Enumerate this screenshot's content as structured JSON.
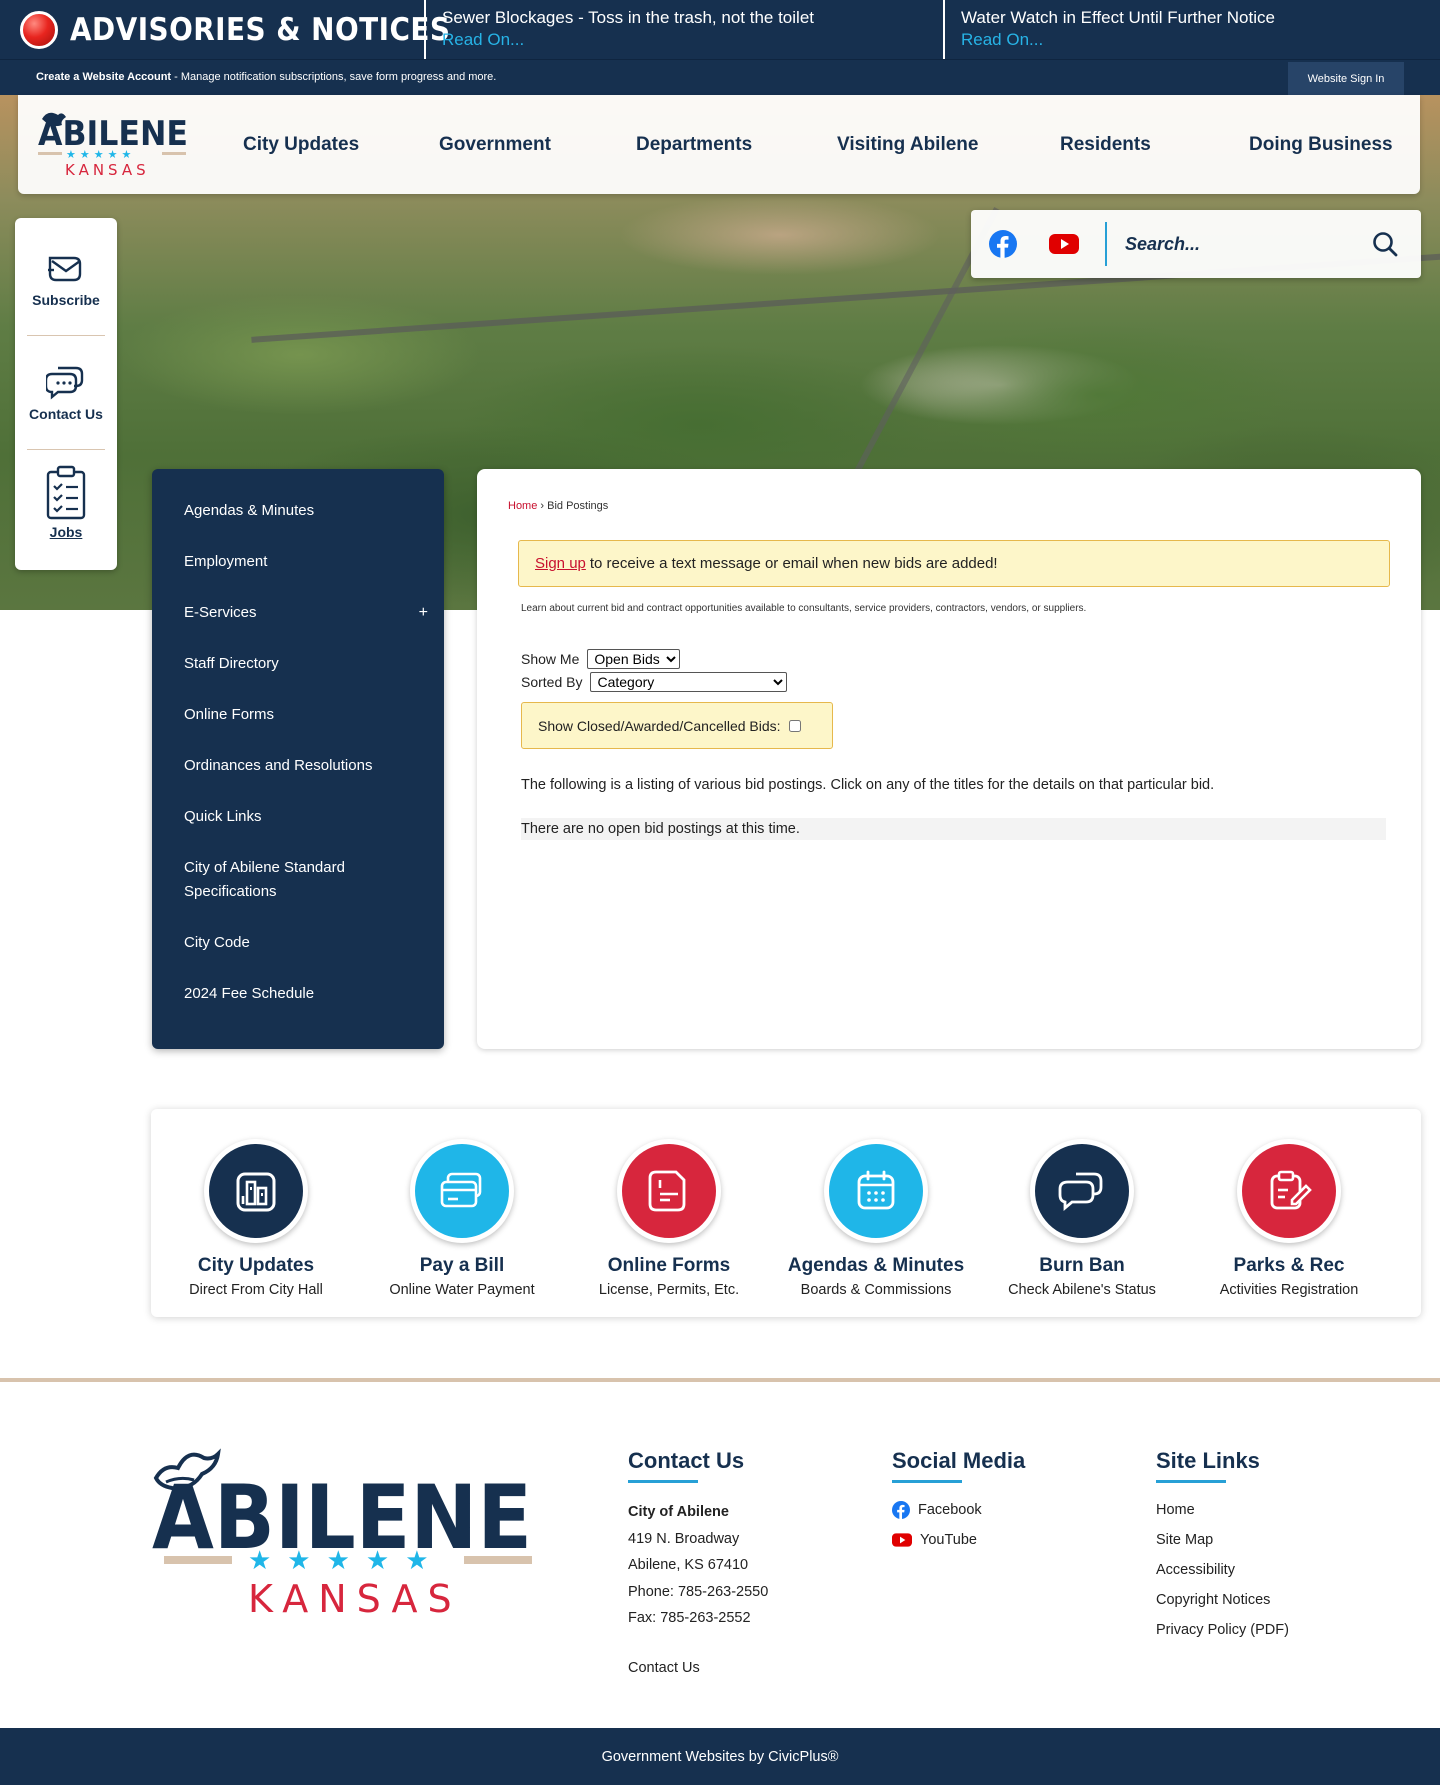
{
  "advisories": {
    "title": "ADVISORIES & NOTICES",
    "items": [
      {
        "title": "Sewer Blockages - Toss in the trash, not the toilet",
        "link": "Read On..."
      },
      {
        "title": "Water Watch in Effect Until Further Notice",
        "link": "Read On..."
      }
    ]
  },
  "account_bar": {
    "create_label": "Create a Website Account",
    "create_desc": " - Manage notification subscriptions, save form progress and more.",
    "signin_label": "Website Sign In"
  },
  "header": {
    "logo_text": "ABILENE",
    "logo_sub": "KANSAS",
    "nav": [
      "City Updates",
      "Government",
      "Departments",
      "Visiting Abilene",
      "Residents",
      "Doing Business"
    ]
  },
  "search": {
    "placeholder": "Search..."
  },
  "quick_actions": [
    {
      "label": "Subscribe"
    },
    {
      "label": "Contact Us"
    },
    {
      "label": "Jobs"
    }
  ],
  "sidenav": {
    "items": [
      "Agendas & Minutes",
      "Employment",
      "E-Services",
      "Staff Directory",
      "Online Forms",
      "Ordinances and Resolutions",
      "Quick Links",
      "City of Abilene Standard Specifications",
      "City Code",
      "2024 Fee Schedule"
    ],
    "expand_symbol": "+"
  },
  "main": {
    "breadcrumb": {
      "home": "Home",
      "separator": " › ",
      "current": "Bid Postings"
    },
    "alert": {
      "link": "Sign up",
      "text": "to receive a text message or email when new bids are added!"
    },
    "intro_small": "Learn about current bid and contract opportunities available to consultants, service providers, contractors, vendors, or suppliers.",
    "show_me_label": "Show Me",
    "show_me_value": "Open Bids",
    "sorted_by_label": "Sorted By",
    "sorted_by_value": "Category",
    "closed_label": "Show Closed/Awarded/Cancelled Bids:",
    "listing_intro": "The following is a listing of various bid postings. Click on any of the titles for the details on that particular bid.",
    "no_bids": "There are no open bid postings at this time."
  },
  "quick_links": [
    {
      "title": "City Updates",
      "sub": "Direct From City Hall",
      "color": "#16304f",
      "icon": "building-icon"
    },
    {
      "title": "Pay a Bill",
      "sub": "Online Water Payment",
      "color": "#1fb6e8",
      "icon": "credit-card-icon"
    },
    {
      "title": "Online Forms",
      "sub": "License, Permits, Etc.",
      "color": "#d7263d",
      "icon": "form-icon"
    },
    {
      "title": "Agendas & Minutes",
      "sub": "Boards & Commissions",
      "color": "#1fb6e8",
      "icon": "calendar-icon"
    },
    {
      "title": "Burn Ban",
      "sub": "Check Abilene's Status",
      "color": "#16304f",
      "icon": "chat-icon"
    },
    {
      "title": "Parks & Rec",
      "sub": "Activities Registration",
      "color": "#d7263d",
      "icon": "clipboard-edit-icon"
    }
  ],
  "footer": {
    "logo_text": "ABILENE",
    "logo_sub": "KANSAS",
    "contact": {
      "title": "Contact Us",
      "org": "City of Abilene",
      "lines": [
        "419 N. Broadway",
        "Abilene, KS 67410",
        "Phone: 785-263-2550",
        "Fax: 785-263-2552"
      ],
      "link": "Contact Us"
    },
    "social": {
      "title": "Social Media",
      "links": [
        "Facebook",
        "YouTube"
      ]
    },
    "site_links": {
      "title": "Site Links",
      "links": [
        "Home",
        "Site Map",
        "Accessibility",
        "Copyright Notices",
        "Privacy Policy (PDF)"
      ]
    },
    "bottom_text": "Government Websites by CivicPlus®"
  },
  "colors": {
    "navy": "#16304f",
    "sky": "#27a0d6",
    "red": "#c8102e",
    "tan": "#d8c3ad",
    "alert_bg": "#fdf6c9"
  }
}
